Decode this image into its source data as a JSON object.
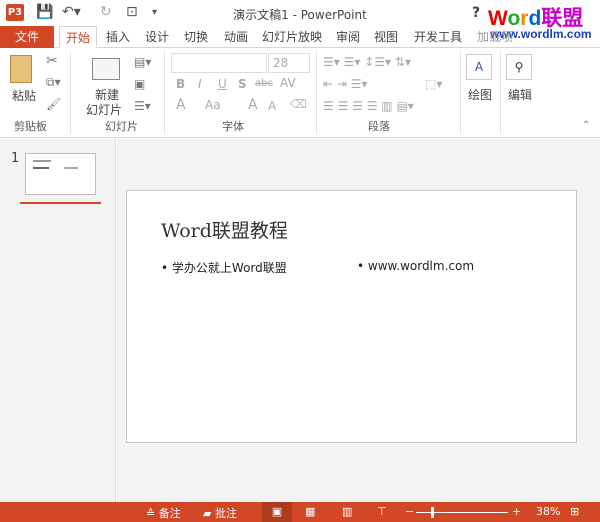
{
  "window": {
    "title": "演示文稿1 - PowerPoint",
    "help": "?",
    "app_icon": "P3"
  },
  "watermark": {
    "brand": "Word联盟",
    "url": "www.wordlm.com"
  },
  "tabs": [
    "文件",
    "开始",
    "插入",
    "设计",
    "切换",
    "动画",
    "幻灯片放映",
    "审阅",
    "视图",
    "开发工具",
    "加载项"
  ],
  "ribbon": {
    "clipboard": {
      "paste": "粘贴",
      "label": "剪贴板"
    },
    "slides": {
      "new_slide_1": "新建",
      "new_slide_2": "幻灯片",
      "label": "幻灯片"
    },
    "font": {
      "font_name": "",
      "font_size": "28",
      "bold": "B",
      "italic": "I",
      "underline": "U",
      "shadow": "S",
      "strike": "abc",
      "spacing": "AV",
      "color": "A",
      "case": "Aa",
      "grow": "A",
      "shrink": "A",
      "label": "字体"
    },
    "paragraph": {
      "label": "段落"
    },
    "drawing": {
      "label": "绘图"
    },
    "editing": {
      "label": "编辑"
    }
  },
  "thumbnails": [
    {
      "number": "1"
    }
  ],
  "slide": {
    "title": "Word联盟教程",
    "bullets": [
      "学办公就上Word联盟",
      "www.wordlm.com"
    ]
  },
  "status": {
    "notes": "备注",
    "comments": "批注",
    "zoom": "38%",
    "zoom_value": 38
  }
}
